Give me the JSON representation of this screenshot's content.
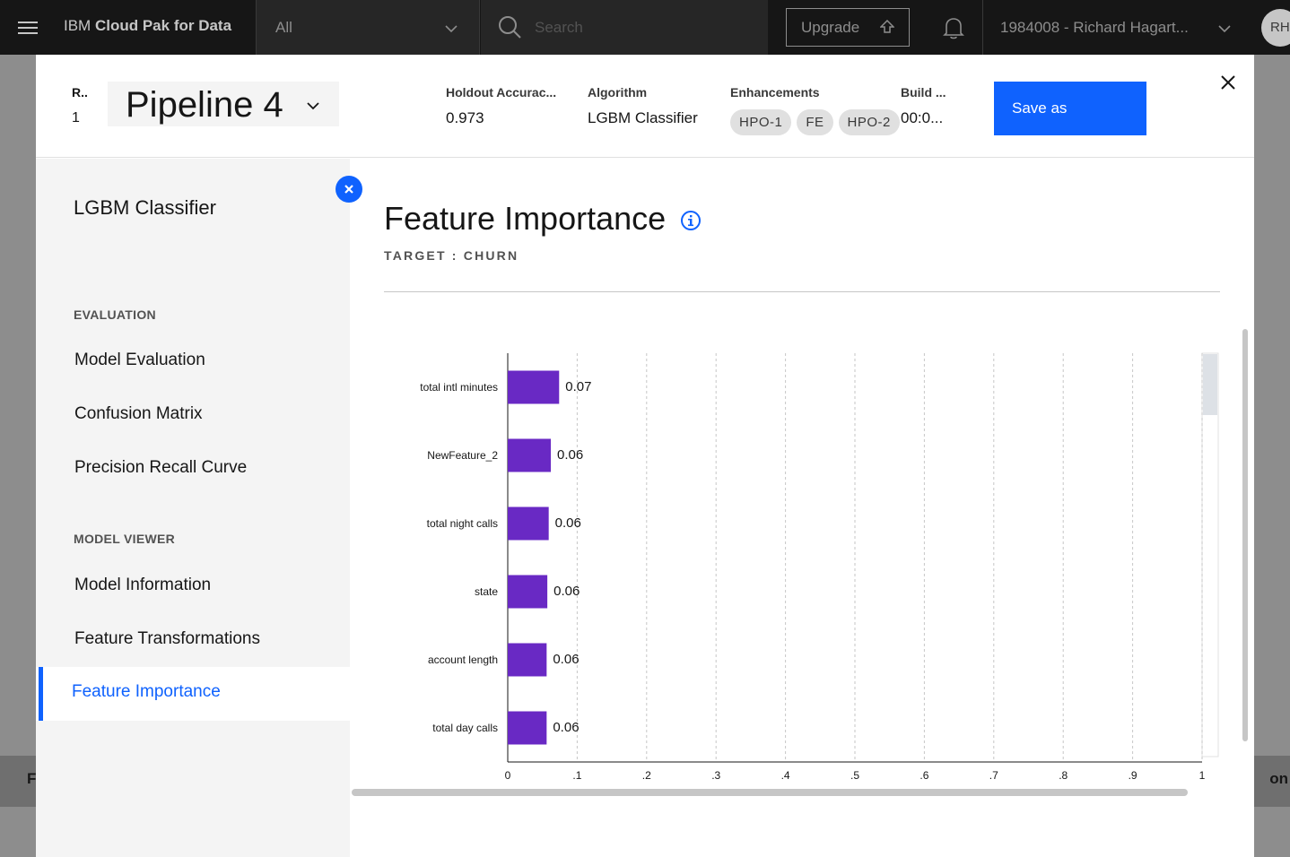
{
  "topbar": {
    "brand_prefix": "IBM",
    "brand_name": "Cloud Pak for Data",
    "scope_label": "All",
    "search_placeholder": "Search",
    "upgrade_label": "Upgrade",
    "account_label": "1984008 - Richard Hagart...",
    "avatar_initials": "RH"
  },
  "background": {
    "left_fragment": "F",
    "right_fragment": "on"
  },
  "modal": {
    "rank_label": "R..",
    "rank_value": "1",
    "pipeline_name": "Pipeline 4",
    "holdout_label": "Holdout Accurac...",
    "holdout_value": "0.973",
    "algorithm_label": "Algorithm",
    "algorithm_value": "LGBM Classifier",
    "enhancements_label": "Enhancements",
    "enhancements": [
      "HPO-1",
      "FE",
      "HPO-2"
    ],
    "build_label": "Build ...",
    "build_value": "00:0...",
    "save_label": "Save as"
  },
  "sidebar": {
    "title": "LGBM Classifier",
    "evaluation_heading": "EVALUATION",
    "evaluation_items": [
      "Model Evaluation",
      "Confusion Matrix",
      "Precision Recall Curve"
    ],
    "viewer_heading": "MODEL VIEWER",
    "viewer_items": [
      "Model Information",
      "Feature Transformations",
      "Feature Importance"
    ],
    "active_item": "Feature Importance"
  },
  "content": {
    "heading": "Feature Importance",
    "target_label": "TARGET : CHURN"
  },
  "chart_data": {
    "type": "bar",
    "orientation": "horizontal",
    "categories": [
      "total intl minutes",
      "NewFeature_2",
      "total night calls",
      "state",
      "account length",
      "total day calls"
    ],
    "values": [
      0.074,
      0.062,
      0.059,
      0.057,
      0.056,
      0.056
    ],
    "data_labels": [
      "0.07",
      "0.06",
      "0.06",
      "0.06",
      "0.06",
      "0.06"
    ],
    "xlim": [
      0,
      1
    ],
    "x_ticks": [
      "0",
      ".1",
      ".2",
      ".3",
      ".4",
      ".5",
      ".6",
      ".7",
      ".8",
      ".9",
      "1"
    ],
    "grid": "vertical dashed",
    "bar_color": "#6929c4"
  }
}
